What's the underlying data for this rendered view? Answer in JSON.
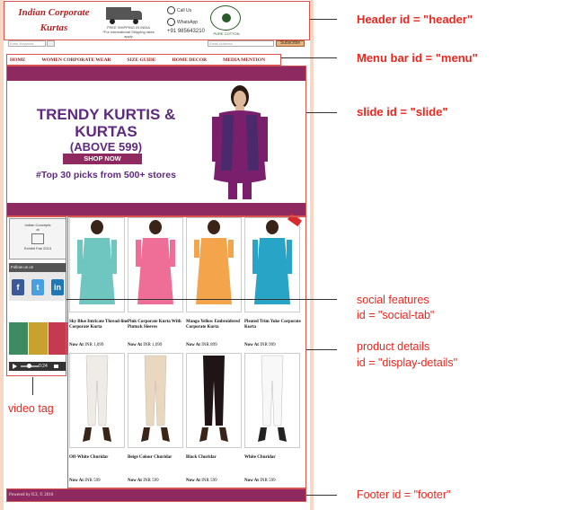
{
  "header": {
    "brand_line1": "Indian Corporate",
    "brand_line2": "Kurtas",
    "shipping_text1": "FREE SHIPPING IN INDIA",
    "shipping_text2": "*For International Shipping rates apply",
    "call_label": "Call Us",
    "whatsapp_label": "WhatsApp",
    "phone": "+91 985643210",
    "cotton_label": "PURE COTTON"
  },
  "search": {
    "keyword_placeholder": "Enter Keyword",
    "email_placeholder": "Email Address",
    "subscribe_label": "Subscribe"
  },
  "menu": {
    "items": [
      "HOME",
      "WOMEN CORPORATE WEAR",
      "SIZE GUIDE",
      "HOME DECOR",
      "MEDIA MENTION"
    ]
  },
  "slide": {
    "headline": "TRENDY KURTIS & KURTAS",
    "subline": "(ABOVE 599)",
    "button_label": "SHOP NOW",
    "footline": "#Top 30 picks from 500+ stores"
  },
  "social": {
    "concepts_line1": "Indian Concepts",
    "concepts_line2": "at",
    "concepts_line3": "Exhibit Fair 2013",
    "follow_label": "Follow us on",
    "icons": [
      "facebook-icon",
      "twitter-icon",
      "linkedin-icon"
    ],
    "video_time": "0:24"
  },
  "products": [
    {
      "name": "Sky Blue Intricate Thread-line Corporate Kurta",
      "price_label": "Now At",
      "price": "INR 1,099",
      "color": "#6fc6c0"
    },
    {
      "name": "Pink Corporate Kurta With Pintuck Sleeves",
      "price_label": "Now At",
      "price": "INR 1,099",
      "color": "#ee6e98"
    },
    {
      "name": "Mango Yellow Embroidered Corporate Kurta",
      "price_label": "Now At",
      "price": "INR 899",
      "color": "#f4a54c"
    },
    {
      "name": "Pleated Trim Yoke Corporate Kurta",
      "price_label": "Now At",
      "price": "INR 999",
      "color": "#27a4c6"
    },
    {
      "name": "Off-White Churidar",
      "price_label": "Now At",
      "price": "INR 599",
      "color": "#efebe6"
    },
    {
      "name": "Beige Colour Churidar",
      "price_label": "Now At",
      "price": "INR 599",
      "color": "#ead7c0"
    },
    {
      "name": "Black Churidar",
      "price_label": "Now At",
      "price": "INR 599",
      "color": "#1f1416"
    },
    {
      "name": "White Churidar",
      "price_label": "Now At",
      "price": "INR 599",
      "color": "#f8f8f8"
    }
  ],
  "footer": {
    "text": "Powered by ICI, © 2016"
  },
  "annotations": {
    "header": "Header id = \"header\"",
    "menu": "Menu bar id = \"menu\"",
    "slide": "slide id = \"slide\"",
    "social_1": "social features",
    "social_2": "id = \"social-tab\"",
    "product_1": "product details",
    "product_2": "id = \"display-details\"",
    "video": "video tag",
    "footer": "Footer id = \"footer\""
  },
  "colors": {
    "accent": "#8e2a5f",
    "annotation": "#e8271f",
    "page_bg": "#f7d8c4"
  }
}
